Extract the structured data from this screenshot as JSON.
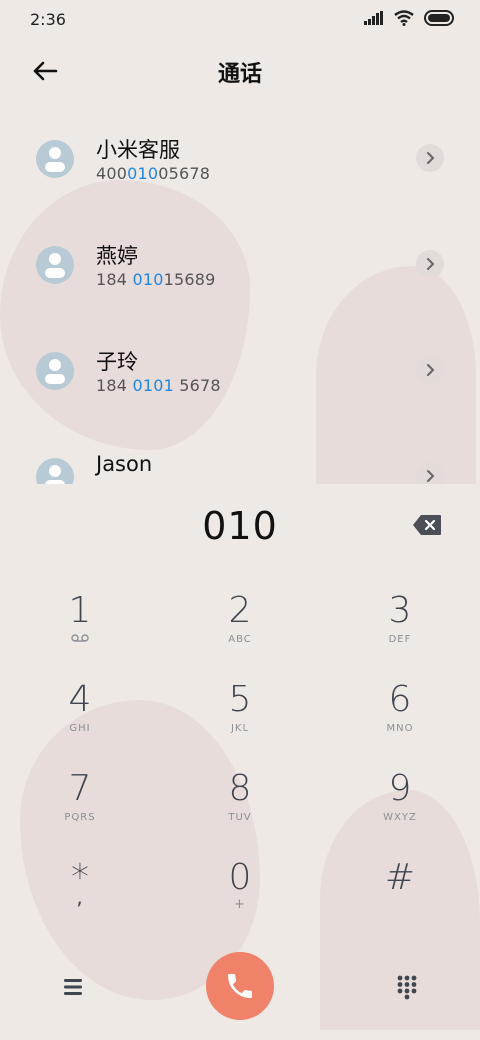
{
  "status_bar": {
    "time": "2:36"
  },
  "header": {
    "title": "通话"
  },
  "contacts": [
    {
      "name": "小米客服",
      "number_parts": [
        "400",
        "010",
        "05678"
      ]
    },
    {
      "name": "燕婷",
      "number_parts": [
        "184 ",
        "010",
        "15689"
      ]
    },
    {
      "name": "子玲",
      "number_parts": [
        "184 ",
        "0101",
        " 5678"
      ]
    },
    {
      "name": "Jason",
      "number_parts": [
        "",
        "",
        ""
      ]
    }
  ],
  "dialer": {
    "digits": "010"
  },
  "keypad": [
    {
      "num": "1",
      "sub": "voicemail"
    },
    {
      "num": "2",
      "sub": "ABC"
    },
    {
      "num": "3",
      "sub": "DEF"
    },
    {
      "num": "4",
      "sub": "GHI"
    },
    {
      "num": "5",
      "sub": "JKL"
    },
    {
      "num": "6",
      "sub": "MNO"
    },
    {
      "num": "7",
      "sub": "PQRS"
    },
    {
      "num": "8",
      "sub": "TUV"
    },
    {
      "num": "9",
      "sub": "WXYZ"
    },
    {
      "num": "*",
      "sub": ","
    },
    {
      "num": "0",
      "sub": "+"
    },
    {
      "num": "#",
      "sub": ""
    }
  ],
  "colors": {
    "accent": "#1e88e5",
    "call": "#f0826a",
    "background": "#efe9e6"
  },
  "icons": [
    "signal-icon",
    "wifi-icon",
    "battery-icon",
    "back-arrow-icon",
    "chevron-right-icon",
    "backspace-icon",
    "menu-icon",
    "phone-icon",
    "dialpad-icon"
  ]
}
